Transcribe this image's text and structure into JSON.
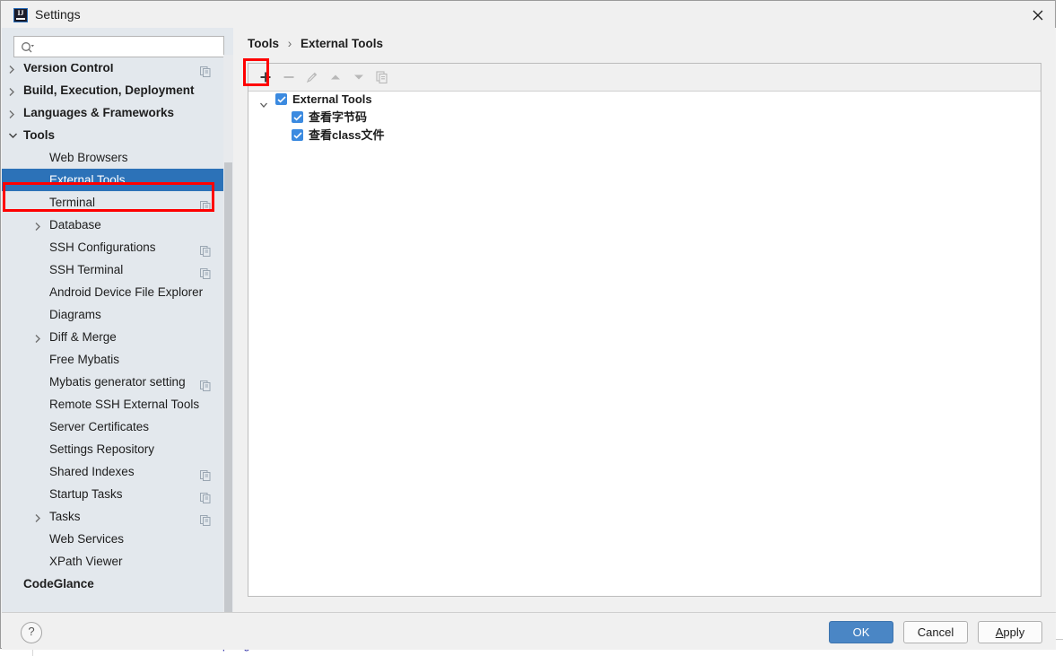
{
  "window": {
    "title": "Settings",
    "app_icon": "intellij-idea-logo",
    "close_icon": "close-icon"
  },
  "background": {
    "code_fragment": "</plugins>"
  },
  "search": {
    "icon": "search-icon",
    "value": "",
    "placeholder": ""
  },
  "sidebar": {
    "cut_off_item_above": "",
    "items": [
      {
        "label": "Version Control",
        "bold": true,
        "indent": 24,
        "arrow": "chevron-right",
        "copy_icon": true
      },
      {
        "label": "Build, Execution, Deployment",
        "bold": true,
        "indent": 24,
        "arrow": "chevron-right",
        "copy_icon": false
      },
      {
        "label": "Languages & Frameworks",
        "bold": true,
        "indent": 24,
        "arrow": "chevron-right",
        "copy_icon": false
      },
      {
        "label": "Tools",
        "bold": true,
        "indent": 24,
        "arrow": "chevron-down",
        "copy_icon": false
      },
      {
        "label": "Web Browsers",
        "bold": false,
        "indent": 53,
        "arrow": "none",
        "copy_icon": false
      },
      {
        "label": "External Tools",
        "bold": false,
        "indent": 53,
        "arrow": "none",
        "copy_icon": false,
        "selected": true
      },
      {
        "label": "Terminal",
        "bold": false,
        "indent": 53,
        "arrow": "none",
        "copy_icon": true
      },
      {
        "label": "Database",
        "bold": false,
        "indent": 53,
        "arrow": "chevron-right",
        "copy_icon": false
      },
      {
        "label": "SSH Configurations",
        "bold": false,
        "indent": 53,
        "arrow": "none",
        "copy_icon": true
      },
      {
        "label": "SSH Terminal",
        "bold": false,
        "indent": 53,
        "arrow": "none",
        "copy_icon": true
      },
      {
        "label": "Android Device File Explorer",
        "bold": false,
        "indent": 53,
        "arrow": "none",
        "copy_icon": false
      },
      {
        "label": "Diagrams",
        "bold": false,
        "indent": 53,
        "arrow": "none",
        "copy_icon": false
      },
      {
        "label": "Diff & Merge",
        "bold": false,
        "indent": 53,
        "arrow": "chevron-right",
        "copy_icon": false
      },
      {
        "label": "Free Mybatis",
        "bold": false,
        "indent": 53,
        "arrow": "none",
        "copy_icon": false
      },
      {
        "label": "Mybatis generator setting",
        "bold": false,
        "indent": 53,
        "arrow": "none",
        "copy_icon": true
      },
      {
        "label": "Remote SSH External Tools",
        "bold": false,
        "indent": 53,
        "arrow": "none",
        "copy_icon": false
      },
      {
        "label": "Server Certificates",
        "bold": false,
        "indent": 53,
        "arrow": "none",
        "copy_icon": false
      },
      {
        "label": "Settings Repository",
        "bold": false,
        "indent": 53,
        "arrow": "none",
        "copy_icon": false
      },
      {
        "label": "Shared Indexes",
        "bold": false,
        "indent": 53,
        "arrow": "none",
        "copy_icon": true
      },
      {
        "label": "Startup Tasks",
        "bold": false,
        "indent": 53,
        "arrow": "none",
        "copy_icon": true
      },
      {
        "label": "Tasks",
        "bold": false,
        "indent": 53,
        "arrow": "chevron-right",
        "copy_icon": true
      },
      {
        "label": "Web Services",
        "bold": false,
        "indent": 53,
        "arrow": "none",
        "copy_icon": false
      },
      {
        "label": "XPath Viewer",
        "bold": false,
        "indent": 53,
        "arrow": "none",
        "copy_icon": false
      },
      {
        "label": "CodeGlance",
        "bold": true,
        "indent": 24,
        "arrow": "none",
        "copy_icon": false
      }
    ]
  },
  "breadcrumb": {
    "parent": "Tools",
    "separator": "›",
    "current": "External Tools"
  },
  "toolbar": {
    "buttons": [
      {
        "name": "add-button",
        "icon": "plus-icon",
        "enabled": true
      },
      {
        "name": "remove-button",
        "icon": "minus-icon",
        "enabled": false
      },
      {
        "name": "edit-button",
        "icon": "pencil-icon",
        "enabled": false
      },
      {
        "name": "move-up-button",
        "icon": "arrow-up-icon",
        "enabled": false
      },
      {
        "name": "move-down-button",
        "icon": "arrow-down-icon",
        "enabled": false
      },
      {
        "name": "copy-button",
        "icon": "duplicate-icon",
        "enabled": false
      }
    ]
  },
  "tools_tree": {
    "group": {
      "label": "External Tools",
      "checked": true,
      "expanded": true
    },
    "children": [
      {
        "label": "查看字节码",
        "checked": true
      },
      {
        "label": "查看class文件",
        "checked": true
      }
    ]
  },
  "footer": {
    "help_label": "?",
    "ok_label": "OK",
    "cancel_label": "Cancel",
    "apply_label_underlined": "A",
    "apply_label_rest": "pply"
  },
  "colors": {
    "selection_blue": "#2c72b8",
    "highlight_red": "#fe0000",
    "checkbox_blue": "#3b8ae0",
    "ok_button_blue": "#4a86c5",
    "sidebar_bg": "#e3e8ed",
    "dialog_bg": "#f0f0f0"
  }
}
